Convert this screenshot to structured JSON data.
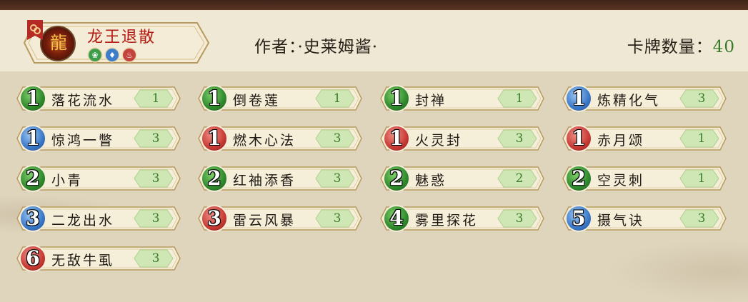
{
  "header": {
    "deck_title": "龙王退散",
    "author": "作者：·史莱姆酱·",
    "card_count_label": "卡牌数量：",
    "card_count": "40",
    "elements": [
      {
        "icon": "wind-element-icon",
        "color": "#3f9c4a",
        "glyph": "❀"
      },
      {
        "icon": "water-element-icon",
        "color": "#3d7cc9",
        "glyph": "♦"
      },
      {
        "icon": "fire-element-icon",
        "color": "#c4423c",
        "glyph": "♨"
      }
    ]
  },
  "cards": [
    {
      "cost": "1",
      "element": "green",
      "name": "落花流水",
      "qty": "1"
    },
    {
      "cost": "1",
      "element": "green",
      "name": "倒卷莲",
      "qty": "1"
    },
    {
      "cost": "1",
      "element": "green",
      "name": "封禅",
      "qty": "1"
    },
    {
      "cost": "1",
      "element": "blue",
      "name": "炼精化气",
      "qty": "3"
    },
    {
      "cost": "1",
      "element": "blue",
      "name": "惊鸿一瞥",
      "qty": "3"
    },
    {
      "cost": "1",
      "element": "red",
      "name": "燃木心法",
      "qty": "3"
    },
    {
      "cost": "1",
      "element": "red",
      "name": "火灵封",
      "qty": "3"
    },
    {
      "cost": "1",
      "element": "red",
      "name": "赤月颂",
      "qty": "1"
    },
    {
      "cost": "2",
      "element": "green",
      "name": "小青",
      "qty": "3"
    },
    {
      "cost": "2",
      "element": "green",
      "name": "红袖添香",
      "qty": "3"
    },
    {
      "cost": "2",
      "element": "green",
      "name": "魅惑",
      "qty": "2"
    },
    {
      "cost": "2",
      "element": "green",
      "name": "空灵刺",
      "qty": "1"
    },
    {
      "cost": "3",
      "element": "blue",
      "name": "二龙出水",
      "qty": "3"
    },
    {
      "cost": "3",
      "element": "red",
      "name": "雷云风暴",
      "qty": "3"
    },
    {
      "cost": "4",
      "element": "green",
      "name": "雾里探花",
      "qty": "3"
    },
    {
      "cost": "5",
      "element": "blue",
      "name": "摄气诀",
      "qty": "3"
    },
    {
      "cost": "6",
      "element": "red",
      "name": "无敌牛虱",
      "qty": "3"
    }
  ]
}
